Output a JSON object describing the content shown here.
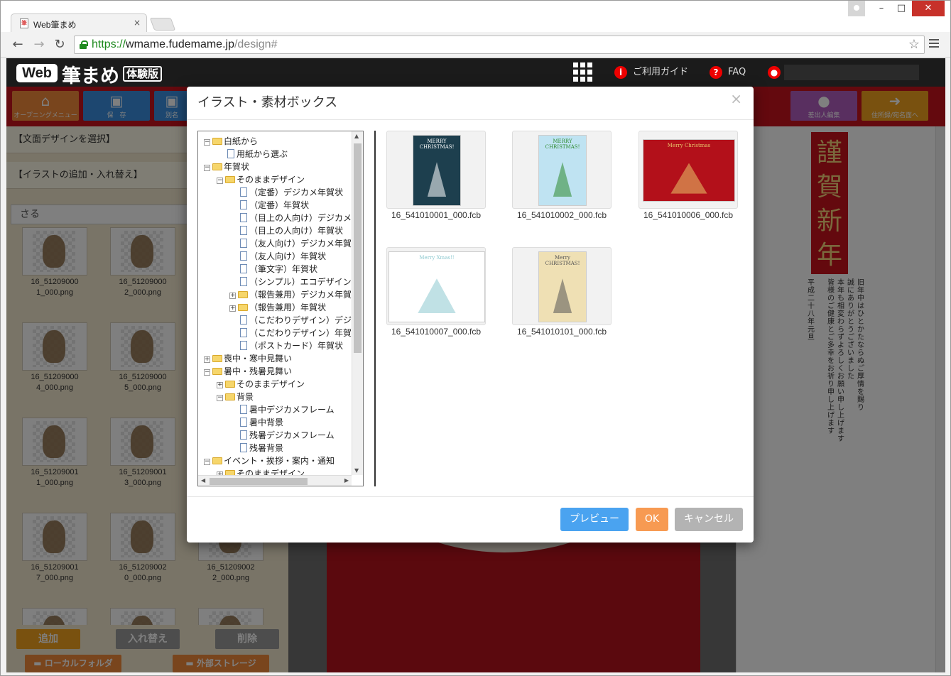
{
  "browser": {
    "tab_title": "Web筆まめ",
    "tab_close": "×",
    "url_scheme": "https://",
    "url_host": "wmame.fudemame.jp",
    "url_path": "/design#",
    "win_min": "–",
    "win_max": "□",
    "win_close": "✕"
  },
  "header": {
    "logo_web": "Web",
    "logo_main": "筆まめ",
    "logo_badge": "体験版",
    "guide": "ご利用ガイド",
    "faq": "FAQ"
  },
  "appbar": {
    "opening": "オープニングメニュー",
    "save": "保　存",
    "saveas": "別名",
    "sender": "差出人編集",
    "address": "住所録/宛名面へ"
  },
  "left_panel": {
    "design_select": "【文面デザインを選択】",
    "illust_add": "【イラストの追加・入れ替え】",
    "search_value": "さる",
    "items": [
      {
        "line1": "16_51209000",
        "line2": "1_000.png"
      },
      {
        "line1": "16_51209000",
        "line2": "2_000.png"
      },
      {
        "line1": "16_51209000",
        "line2": "4_000.png"
      },
      {
        "line1": "16_51209000",
        "line2": "5_000.png"
      },
      {
        "line1": "16_51209001",
        "line2": "1_000.png"
      },
      {
        "line1": "16_51209001",
        "line2": "3_000.png"
      },
      {
        "line1": "16_51209001",
        "line2": "7_000.png"
      },
      {
        "line1": "16_51209002",
        "line2": "0_000.png"
      },
      {
        "line1": "16_51209002",
        "line2": "2_000.png"
      }
    ],
    "add": "追加",
    "replace": "入れ替え",
    "delete": "削除",
    "local_folder": "ローカルフォルダ",
    "external_storage": "外部ストレージ"
  },
  "preview": {
    "nenga": "謹賀新年",
    "greeting_lines": [
      "旧年中はひとかたならぬご厚情を賜り",
      "誠にありがとうございました",
      "本年も相変わらずよろしくお願い申し上げます",
      "皆様のご健康とご多幸をお祈り申し上げます",
      "平成二十八年　元旦"
    ]
  },
  "dialog": {
    "title": "イラスト・素材ボックス",
    "close": "×",
    "tree": [
      {
        "label": "白紙から",
        "indent": 0,
        "expander": "−",
        "icon": "folder"
      },
      {
        "label": "用紙から選ぶ",
        "indent": 1,
        "expander": "",
        "icon": "doc"
      },
      {
        "label": "年賀状",
        "indent": 0,
        "expander": "−",
        "icon": "folder"
      },
      {
        "label": "そのままデザイン",
        "indent": 1,
        "expander": "−",
        "icon": "folder"
      },
      {
        "label": "（定番）デジカメ年賀状",
        "indent": 2,
        "expander": "",
        "icon": "doc"
      },
      {
        "label": "（定番）年賀状",
        "indent": 2,
        "expander": "",
        "icon": "doc"
      },
      {
        "label": "（目上の人向け）デジカメ",
        "indent": 2,
        "expander": "",
        "icon": "doc"
      },
      {
        "label": "（目上の人向け）年賀状",
        "indent": 2,
        "expander": "",
        "icon": "doc"
      },
      {
        "label": "（友人向け）デジカメ年賀",
        "indent": 2,
        "expander": "",
        "icon": "doc"
      },
      {
        "label": "（友人向け）年賀状",
        "indent": 2,
        "expander": "",
        "icon": "doc"
      },
      {
        "label": "（筆文字）年賀状",
        "indent": 2,
        "expander": "",
        "icon": "doc"
      },
      {
        "label": "（シンプル）エコデザイン",
        "indent": 2,
        "expander": "",
        "icon": "doc"
      },
      {
        "label": "（報告兼用）デジカメ年賀",
        "indent": 2,
        "expander": "+",
        "icon": "folder"
      },
      {
        "label": "（報告兼用）年賀状",
        "indent": 2,
        "expander": "+",
        "icon": "folder"
      },
      {
        "label": "（こだわりデザイン）デジ",
        "indent": 2,
        "expander": "",
        "icon": "doc"
      },
      {
        "label": "（こだわりデザイン）年賀",
        "indent": 2,
        "expander": "",
        "icon": "doc"
      },
      {
        "label": "（ポストカード）年賀状",
        "indent": 2,
        "expander": "",
        "icon": "doc"
      },
      {
        "label": "喪中・寒中見舞い",
        "indent": 0,
        "expander": "+",
        "icon": "folder"
      },
      {
        "label": "暑中・残暑見舞い",
        "indent": 0,
        "expander": "−",
        "icon": "folder"
      },
      {
        "label": "そのままデザイン",
        "indent": 1,
        "expander": "+",
        "icon": "folder"
      },
      {
        "label": "背景",
        "indent": 1,
        "expander": "−",
        "icon": "folder"
      },
      {
        "label": "暑中デジカメフレーム",
        "indent": 2,
        "expander": "",
        "icon": "doc"
      },
      {
        "label": "暑中背景",
        "indent": 2,
        "expander": "",
        "icon": "doc"
      },
      {
        "label": "残暑デジカメフレーム",
        "indent": 2,
        "expander": "",
        "icon": "doc"
      },
      {
        "label": "残暑背景",
        "indent": 2,
        "expander": "",
        "icon": "doc"
      },
      {
        "label": "イベント・挨拶・案内・通知",
        "indent": 0,
        "expander": "−",
        "icon": "folder"
      },
      {
        "label": "そのままデザイン",
        "indent": 1,
        "expander": "+",
        "icon": "folder"
      }
    ],
    "thumbs": [
      {
        "name": "16_541010001_000.fcb",
        "bg": "#1d3f4e",
        "accent": "#ffffff",
        "text": "MERRY CHRISTMAS!"
      },
      {
        "name": "16_541010002_000.fcb",
        "bg": "#bfe3f2",
        "accent": "#2d8a2d",
        "text": "MERRY CHRISTMAS!"
      },
      {
        "name": "16_541010006_000.fcb",
        "bg": "#b3101a",
        "accent": "#e8c46a",
        "text": "Merry Christmas"
      },
      {
        "name": "16_541010007_000.fcb",
        "bg": "#ffffff",
        "accent": "#8cc8cf",
        "text": "Merry Xmas!!"
      },
      {
        "name": "16_541010101_000.fcb",
        "bg": "#efe0b4",
        "accent": "#555555",
        "text": "Merry CHRISTMAS!"
      }
    ],
    "preview_btn": "プレビュー",
    "ok_btn": "OK",
    "cancel_btn": "キャンセル"
  },
  "colors": {
    "accent_red": "#c8121c",
    "preview_blue": "#4aa3f0",
    "ok_orange": "#f79a52",
    "cancel_gray": "#b3b3b3"
  }
}
